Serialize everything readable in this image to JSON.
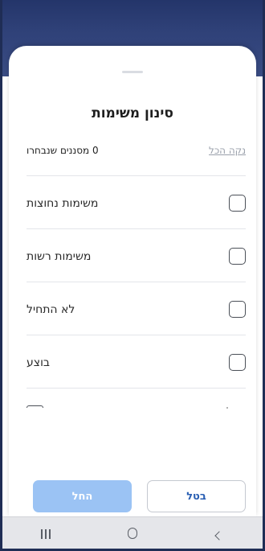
{
  "sheet": {
    "title": "סינון משימות",
    "selected_count_text": "0 מסננים שנבחרו",
    "clear_all_label": "נקה הכל"
  },
  "options": [
    {
      "label": "משימות נחוצות",
      "checked": false
    },
    {
      "label": "משימות רשות",
      "checked": false
    },
    {
      "label": "לא התחיל",
      "checked": false
    },
    {
      "label": "בוצע",
      "checked": false
    }
  ],
  "buttons": {
    "apply_label": "החל",
    "cancel_label": "בטל"
  },
  "colors": {
    "apply_bg": "#9bc3f4",
    "cancel_text": "#2a5fb3",
    "backdrop": "#2f4178"
  },
  "system_nav": {
    "recent_icon": "recent-apps-icon",
    "home_icon": "home-icon",
    "back_icon": "back-icon"
  }
}
